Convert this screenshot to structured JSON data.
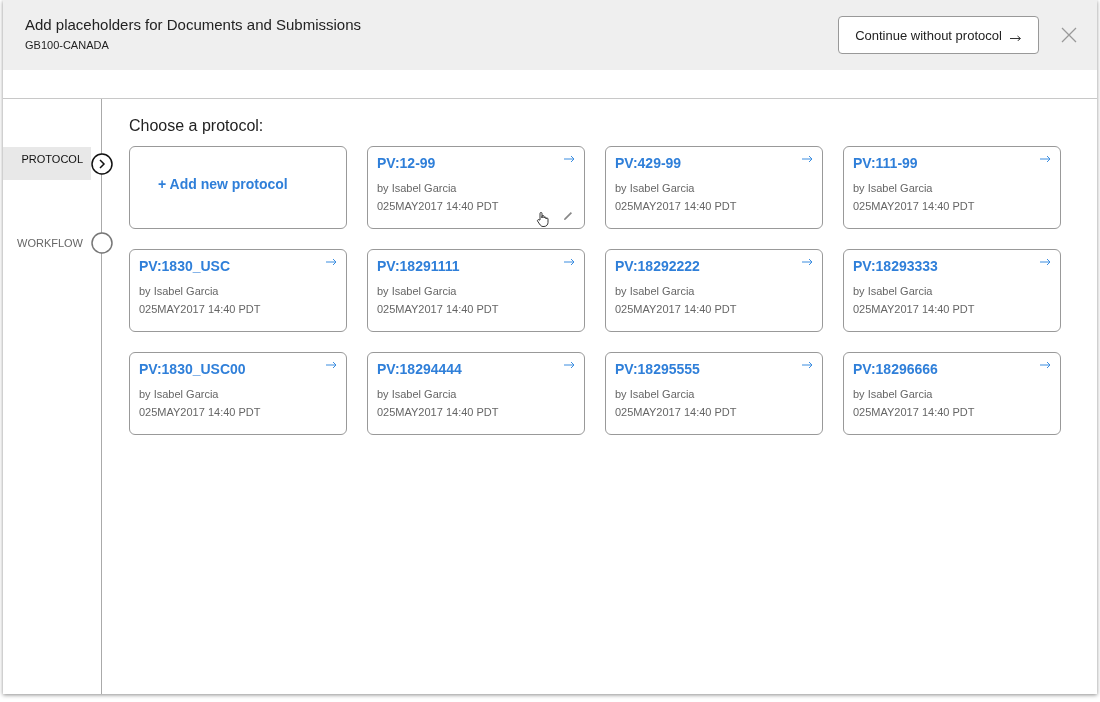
{
  "header": {
    "title": "Add placeholders for Documents and Submissions",
    "subtitle": "GB100-CANADA",
    "continue_button": "Continue without protocol"
  },
  "steps": [
    {
      "label": "PROTOCOL",
      "selected": true
    },
    {
      "label": "WORKFLOW",
      "selected": false
    }
  ],
  "content": {
    "heading": "Choose a protocol:",
    "add_card": "+ Add new protocol",
    "protocols": [
      {
        "name": "PV:12-99",
        "author": "by Isabel Garcia",
        "date": "025MAY2017 14:40 PDT",
        "hovered": true
      },
      {
        "name": "PV:429-99",
        "author": "by Isabel Garcia",
        "date": "025MAY2017 14:40 PDT",
        "hovered": false
      },
      {
        "name": "PV:111-99",
        "author": "by Isabel Garcia",
        "date": "025MAY2017 14:40 PDT",
        "hovered": false
      },
      {
        "name": "PV:1830_USC",
        "author": "by Isabel Garcia",
        "date": "025MAY2017 14:40 PDT",
        "hovered": false
      },
      {
        "name": "PV:18291111",
        "author": "by Isabel Garcia",
        "date": "025MAY2017 14:40 PDT",
        "hovered": false
      },
      {
        "name": "PV:18292222",
        "author": "by Isabel Garcia",
        "date": "025MAY2017 14:40 PDT",
        "hovered": false
      },
      {
        "name": "PV:18293333",
        "author": "by Isabel Garcia",
        "date": "025MAY2017 14:40 PDT",
        "hovered": false
      },
      {
        "name": "PV:1830_USC00",
        "author": "by Isabel Garcia",
        "date": "025MAY2017 14:40 PDT",
        "hovered": false
      },
      {
        "name": "PV:18294444",
        "author": "by Isabel Garcia",
        "date": "025MAY2017 14:40 PDT",
        "hovered": false
      },
      {
        "name": "PV:18295555",
        "author": "by Isabel Garcia",
        "date": "025MAY2017 14:40 PDT",
        "hovered": false
      },
      {
        "name": "PV:18296666",
        "author": "by Isabel Garcia",
        "date": "025MAY2017 14:40 PDT",
        "hovered": false
      }
    ]
  }
}
